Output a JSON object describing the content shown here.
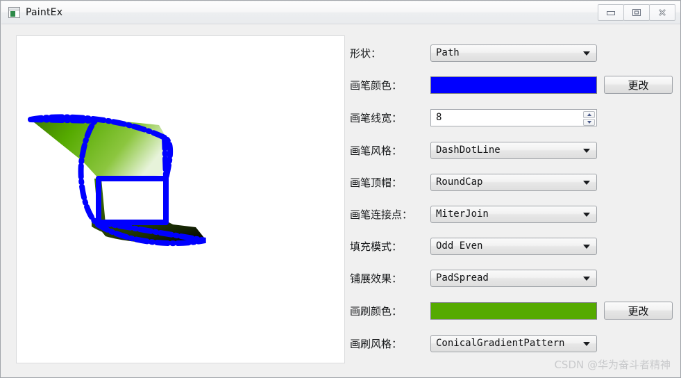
{
  "window": {
    "title": "PaintEx",
    "icon": "app-window-image-icon",
    "controls": {
      "minimize": "minimize-icon",
      "maximize": "maximize-icon",
      "close": "close-icon"
    }
  },
  "canvas": {
    "name": "drawing-canvas",
    "background": "#ffffff",
    "stroke_color": "#0000ff",
    "stroke_width": 8,
    "fill_start": "#55aa00",
    "fill_end": "#000000"
  },
  "form": {
    "rows": [
      {
        "label": "形状：",
        "control": "combo",
        "value": "Path",
        "name": "shape"
      },
      {
        "label": "画笔颜色：",
        "control": "color",
        "value": "#0000FF",
        "name": "pen-color",
        "button": "更改"
      },
      {
        "label": "画笔线宽：",
        "control": "spin",
        "value": "8",
        "name": "pen-width"
      },
      {
        "label": "画笔风格：",
        "control": "combo",
        "value": "DashDotLine",
        "name": "pen-style"
      },
      {
        "label": "画笔顶帽：",
        "control": "combo",
        "value": "RoundCap",
        "name": "pen-cap"
      },
      {
        "label": "画笔连接点：",
        "control": "combo",
        "value": "MiterJoin",
        "name": "pen-join"
      },
      {
        "label": "填充模式：",
        "control": "combo",
        "value": "Odd Even",
        "name": "fill-mode"
      },
      {
        "label": "铺展效果：",
        "control": "combo",
        "value": "PadSpread",
        "name": "spread"
      },
      {
        "label": "画刷颜色：",
        "control": "color",
        "value": "#55AA00",
        "name": "brush-color",
        "button": "更改"
      },
      {
        "label": "画刷风格：",
        "control": "combo",
        "value": "ConicalGradientPattern",
        "name": "brush-style"
      }
    ]
  },
  "watermark": {
    "text": "CSDN @华为奋斗者精神"
  }
}
